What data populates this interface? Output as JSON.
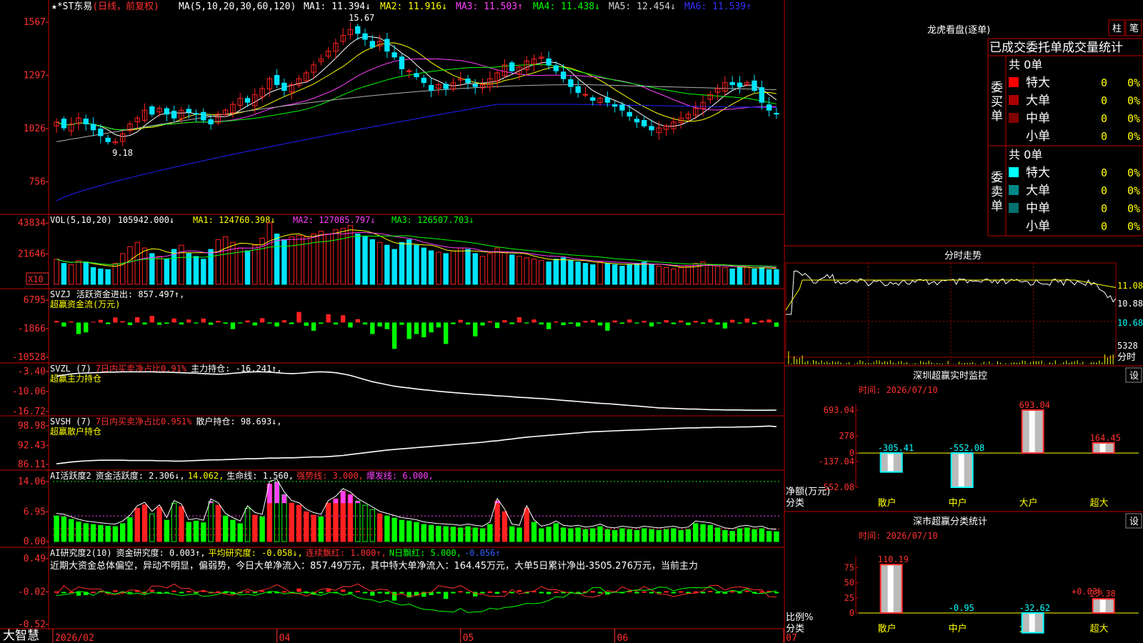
{
  "colors": {
    "up": "#ff2020",
    "down": "#00e5ff",
    "grid": "#a00000",
    "axis": "#ff3030",
    "ma1": "#ffffff",
    "ma2": "#ffff00",
    "ma3": "#ff40ff",
    "ma4": "#00ff00",
    "ma5": "#b0b0b0",
    "ma6": "#2020ff"
  },
  "kline": {
    "header": {
      "stock": "*ST东易",
      "mode": "(日线，前复权)",
      "ma_params": "MA(5,10,20,30,60,120)",
      "ma1": "MA1: 11.394↓",
      "ma2": "MA2: 11.916↓",
      "ma3": "MA3: 11.503↑",
      "ma4": "MA4: 11.438↓",
      "ma5": "MA5: 12.454↓",
      "ma6": "MA6: 11.539↑"
    },
    "y_ticks": [
      "1567",
      "1297",
      "1026",
      "756"
    ],
    "ylim": [
      6.2,
      16.0
    ],
    "high_label": "15.67",
    "low_label": "9.18",
    "closes": [
      10.6,
      10.3,
      10.5,
      10.8,
      10.5,
      10.2,
      9.9,
      9.6,
      9.6,
      10.0,
      10.5,
      10.8,
      11.2,
      11.0,
      11.3,
      11.0,
      10.8,
      11.2,
      11.1,
      11.0,
      10.7,
      10.5,
      11.0,
      11.2,
      11.5,
      11.8,
      11.6,
      12.0,
      12.3,
      12.8,
      12.5,
      12.2,
      12.5,
      12.8,
      13.1,
      13.5,
      13.8,
      14.2,
      14.6,
      15.0,
      15.3,
      15.1,
      14.8,
      14.4,
      14.7,
      14.2,
      13.9,
      13.3,
      13.2,
      12.9,
      12.6,
      12.2,
      12.5,
      12.3,
      12.6,
      12.8,
      12.6,
      12.4,
      12.5,
      12.8,
      13.1,
      13.5,
      13.2,
      13.4,
      13.7,
      13.8,
      13.9,
      13.5,
      13.2,
      12.8,
      12.4,
      12.1,
      12.0,
      11.7,
      11.8,
      11.6,
      11.4,
      11.2,
      10.9,
      10.6,
      10.4,
      10.2,
      10.3,
      10.4,
      10.6,
      10.8,
      11.0,
      11.3,
      11.6,
      12.0,
      12.3,
      12.6,
      12.5,
      12.4,
      12.6,
      12.2,
      11.6,
      11.2,
      11.0
    ]
  },
  "vol": {
    "header": {
      "label": "VOL(5,10,20)",
      "value": "105942.000↓",
      "ma1": "MA1: 124760.398↓",
      "ma2": "MA2: 127085.797↓",
      "ma3": "MA3: 126507.703↓"
    },
    "y_ticks": [
      "43834",
      "21646"
    ],
    "unit": "X10",
    "ylim": [
      0,
      48000
    ],
    "values": [
      18000,
      15000,
      14000,
      17000,
      16000,
      12000,
      11000,
      10500,
      15000,
      22000,
      27000,
      30000,
      26000,
      22000,
      20000,
      18000,
      25000,
      28000,
      22000,
      20000,
      18000,
      25000,
      32000,
      34000,
      30000,
      26000,
      24000,
      28000,
      33000,
      44000,
      36000,
      32000,
      34000,
      35000,
      34000,
      36000,
      38000,
      36000,
      39000,
      40000,
      42000,
      36000,
      34000,
      32000,
      30000,
      28000,
      25000,
      30000,
      32000,
      28000,
      26000,
      24000,
      23000,
      22000,
      24000,
      26000,
      25000,
      22000,
      20000,
      22000,
      26000,
      23000,
      21000,
      20000,
      19000,
      18000,
      17000,
      16000,
      18000,
      19000,
      17000,
      16000,
      15000,
      14000,
      16000,
      15000,
      14000,
      13000,
      14000,
      15000,
      16000,
      14000,
      13000,
      12000,
      11000,
      12000,
      13000,
      15000,
      16000,
      14000,
      13000,
      12000,
      11000,
      12000,
      13000,
      11000,
      12000,
      10500,
      10500
    ]
  },
  "svzj": {
    "header": {
      "label": "SVZJ",
      "desc": "活跃资金进出: 857.497↑,",
      "sub": "超赢资金流(万元)"
    },
    "y_ticks": [
      "6795",
      "-1866",
      "-10528"
    ],
    "ylim": [
      -10528,
      6795
    ],
    "values": [
      500,
      -1200,
      300,
      -3500,
      -3000,
      200,
      800,
      -500,
      1500,
      400,
      -800,
      1600,
      -600,
      2000,
      -700,
      -400,
      1200,
      -600,
      900,
      -300,
      1200,
      -700,
      500,
      -400,
      -2000,
      -300,
      600,
      -900,
      1300,
      -300,
      -1200,
      700,
      -500,
      3200,
      -1000,
      -2500,
      -400,
      2500,
      -600,
      2200,
      -1500,
      1000,
      -600,
      -3500,
      -1200,
      -2000,
      -8000,
      -700,
      -5000,
      -3500,
      -4500,
      -3000,
      -1500,
      -6500,
      -500,
      800,
      -600,
      -4200,
      -900,
      400,
      -1700,
      700,
      -500,
      1600,
      -300,
      900,
      -600,
      -2000,
      300,
      -800,
      -400,
      -1200,
      500,
      700,
      -900,
      -2500,
      600,
      -400,
      900,
      -300,
      500,
      -1200,
      -300,
      700,
      -500,
      600,
      -800,
      500,
      -400,
      1000,
      -600,
      -1800,
      800,
      -300,
      1200,
      -500,
      600,
      900,
      -1300
    ]
  },
  "svzl": {
    "header": {
      "label": "SVZL (7)",
      "desc": "7日内买卖净占比0.91%",
      "hold": "主力持仓: -16.241↑,",
      "sub": "超赢主力持仓"
    },
    "y_ticks": [
      "-3.40",
      "-10.06",
      "-16.72"
    ],
    "ylim": [
      -16.72,
      -3.4
    ],
    "values": [
      -5.0,
      -4.6,
      -4.2,
      -4.0,
      -3.9,
      -3.8,
      -3.7,
      -3.6,
      -3.6,
      -3.5,
      -3.5,
      -3.5,
      -3.5,
      -3.5,
      -3.6,
      -3.6,
      -3.7,
      -3.8,
      -3.9,
      -4.0,
      -4.1,
      -4.2,
      -4.3,
      -4.2,
      -4.0,
      -3.8,
      -3.6,
      -3.5,
      -3.5,
      -3.6,
      -3.8,
      -4.0,
      -4.1,
      -4.0,
      -3.8,
      -3.6,
      -3.5,
      -3.6,
      -3.8,
      -4.2,
      -4.7,
      -5.4,
      -6.1,
      -6.8,
      -7.3,
      -7.8,
      -8.3,
      -8.6,
      -8.9,
      -9.2,
      -9.5,
      -9.7,
      -10.0,
      -10.2,
      -10.4,
      -10.6,
      -10.8,
      -11.0,
      -11.1,
      -11.3,
      -11.5,
      -11.6,
      -11.8,
      -12.0,
      -12.1,
      -12.3,
      -12.4,
      -12.6,
      -12.8,
      -13.0,
      -13.2,
      -13.4,
      -13.6,
      -13.8,
      -14.0,
      -14.1,
      -14.3,
      -14.5,
      -14.7,
      -14.9,
      -15.1,
      -15.3,
      -15.5,
      -15.6,
      -15.7,
      -15.8,
      -15.9,
      -15.9,
      -16.0,
      -16.1,
      -16.1,
      -16.2,
      -16.2,
      -16.2,
      -16.3,
      -16.3,
      -16.3,
      -16.3,
      -16.24
    ]
  },
  "svsh": {
    "header": {
      "label": "SVSH (7)",
      "desc": "7日内买卖净占比0.951%",
      "hold": "散户持仓: 98.693↓,",
      "sub": "超赢散户持仓"
    },
    "y_ticks": [
      "98.98",
      "92.43",
      "86.11"
    ],
    "ylim": [
      86.11,
      98.98
    ],
    "values": [
      86.3,
      86.6,
      86.9,
      87.1,
      87.3,
      87.4,
      87.5,
      87.5,
      87.5,
      87.5,
      87.4,
      87.4,
      87.4,
      87.4,
      87.3,
      87.3,
      87.2,
      87.2,
      87.3,
      87.4,
      87.5,
      87.6,
      87.6,
      87.7,
      87.8,
      87.9,
      88.0,
      88.0,
      88.1,
      88.2,
      88.2,
      88.3,
      88.3,
      88.4,
      88.5,
      88.6,
      88.6,
      88.7,
      88.9,
      89.1,
      89.4,
      89.7,
      90.0,
      90.3,
      90.6,
      90.9,
      91.1,
      91.3,
      91.5,
      91.7,
      91.9,
      92.1,
      92.3,
      92.5,
      92.7,
      92.9,
      93.1,
      93.3,
      93.5,
      93.8,
      94.0,
      94.3,
      94.6,
      94.9,
      95.2,
      95.4,
      95.6,
      95.8,
      96.0,
      96.2,
      96.4,
      96.6,
      96.8,
      97.0,
      97.1,
      97.2,
      97.3,
      97.4,
      97.5,
      97.6,
      97.7,
      97.8,
      97.9,
      98.0,
      98.1,
      98.2,
      98.3,
      98.3,
      98.4,
      98.4,
      98.5,
      98.5,
      98.5,
      98.6,
      98.6,
      98.7,
      98.8,
      98.9,
      98.69
    ]
  },
  "ai1": {
    "header": {
      "label": "AI活跃度2",
      "desc": "资金活跃度: 2.306↓,",
      "v2": "14.062,",
      "life": "生命线: 1.560,",
      "strong": "强势线: 3.000,",
      "burst": "爆发线: 6.000,"
    },
    "y_ticks": [
      "14.06",
      "6.95",
      "0.00"
    ],
    "ylim": [
      0,
      14.06
    ],
    "values": [
      6.0,
      5.8,
      5.2,
      4.6,
      4.2,
      4.0,
      3.8,
      3.6,
      3.5,
      4.2,
      5.6,
      7.8,
      8.6,
      6.5,
      8.0,
      5.0,
      9.0,
      8.2,
      4.5,
      4.8,
      4.4,
      9.4,
      8.5,
      6.0,
      5.0,
      4.2,
      7.8,
      6.2,
      5.8,
      13.5,
      14.0,
      11.0,
      9.0,
      8.5,
      7.0,
      6.2,
      5.8,
      9.0,
      10.0,
      11.8,
      11.0,
      9.5,
      8.5,
      7.5,
      6.5,
      6.0,
      5.5,
      5.0,
      4.8,
      4.5,
      4.0,
      3.8,
      3.6,
      3.5,
      3.4,
      3.2,
      3.5,
      3.2,
      3.0,
      4.0,
      9.5,
      7.0,
      3.5,
      3.2,
      7.8,
      4.5,
      3.0,
      3.4,
      4.2,
      3.2,
      3.0,
      3.2,
      2.8,
      3.0,
      3.5,
      2.8,
      2.6,
      3.0,
      2.8,
      2.6,
      3.0,
      2.8,
      2.6,
      2.8,
      3.0,
      2.6,
      2.8,
      4.2,
      4.0,
      3.8,
      3.2,
      2.6,
      2.4,
      3.0,
      3.2,
      2.8,
      3.0,
      2.4,
      2.3
    ],
    "lines": [
      1.56,
      3.0,
      6.0,
      14.06
    ]
  },
  "ai2": {
    "header": {
      "label": "AI研究度2(10)",
      "desc": "资金研究度: 0.003↑,",
      "avg": "平均研究度: -0.058↓,",
      "red": "连续飘红: 1.000↑,",
      "nred": "N日飘红: 5.000,",
      "neg": "-0.056↑"
    },
    "note": "近期大资金总体偏空，异动不明显，偏弱势，今日大单净流入：857.49万元，其中特大单净流入：164.45万元，大单5日累计净出-3505.276万元，当前主力",
    "y_ticks": [
      "0.49",
      "-0.02",
      "-0.52"
    ],
    "ylim": [
      -0.52,
      0.49
    ]
  },
  "xaxis": {
    "labels": [
      "2026/02",
      "04",
      "05",
      "06",
      "07"
    ],
    "positions": [
      0,
      30,
      55,
      76,
      99
    ]
  },
  "bottom_logo": "大智慧",
  "right": {
    "dragon": {
      "title": "龙虎看盘(逐单)",
      "btn1": "柱",
      "btn2": "笔",
      "subtitle": "已成交委托单成交量统计",
      "buy": {
        "side": "委买单",
        "total": "共 0单",
        "rows": [
          {
            "name": "特大",
            "v": "0",
            "p": "0%",
            "c": "#ff0000"
          },
          {
            "name": "大单",
            "v": "0",
            "p": "0%",
            "c": "#aa0000"
          },
          {
            "name": "中单",
            "v": "0",
            "p": "0%",
            "c": "#800000"
          },
          {
            "name": "小单",
            "v": "0",
            "p": "0%",
            "c": ""
          }
        ]
      },
      "sell": {
        "side": "委卖单",
        "total": "共 0单",
        "rows": [
          {
            "name": "特大",
            "v": "0",
            "p": "0%",
            "c": "#00ffff"
          },
          {
            "name": "大单",
            "v": "0",
            "p": "0%",
            "c": "#008888"
          },
          {
            "name": "中单",
            "v": "0",
            "p": "0%",
            "c": "#007070"
          },
          {
            "name": "小单",
            "v": "0",
            "p": "0%",
            "c": ""
          }
        ]
      }
    },
    "intraday": {
      "title": "分时走势",
      "ticks": [
        "11.08",
        "10.88",
        "10.68"
      ],
      "vol": "5328",
      "vol_label": "分时"
    },
    "sz_monitor": {
      "title": "深圳超赢实时监控",
      "btn": "设",
      "time": "时间: 2026/07/10",
      "y_ticks": [
        "693.04",
        "278",
        "0",
        "-137.04",
        "-552.08"
      ],
      "ylabel": "净额(万元)",
      "xlabel": "分类",
      "cats": [
        "散户",
        "中户",
        "大户",
        "超大"
      ],
      "values": [
        -305.41,
        -552.08,
        693.04,
        164.45
      ],
      "labels": [
        "-305.41",
        "-552.08",
        "693.04",
        "164.45"
      ]
    },
    "sz_class": {
      "title": "深市超赢分类统计",
      "btn": "设",
      "time": "时间: 2026/07/10",
      "y_ticks": [
        "75",
        "50",
        "25",
        "0"
      ],
      "ylabel": "比例%",
      "xlabel": "分类",
      "cats": [
        "散户",
        "中户",
        "大户",
        "超大"
      ],
      "values": [
        110.19,
        -0.95,
        -32.62,
        23.38
      ],
      "labels": [
        "110.19",
        "-0.95",
        "-32.62",
        "23.38"
      ],
      "extra": "+0.03%"
    }
  }
}
